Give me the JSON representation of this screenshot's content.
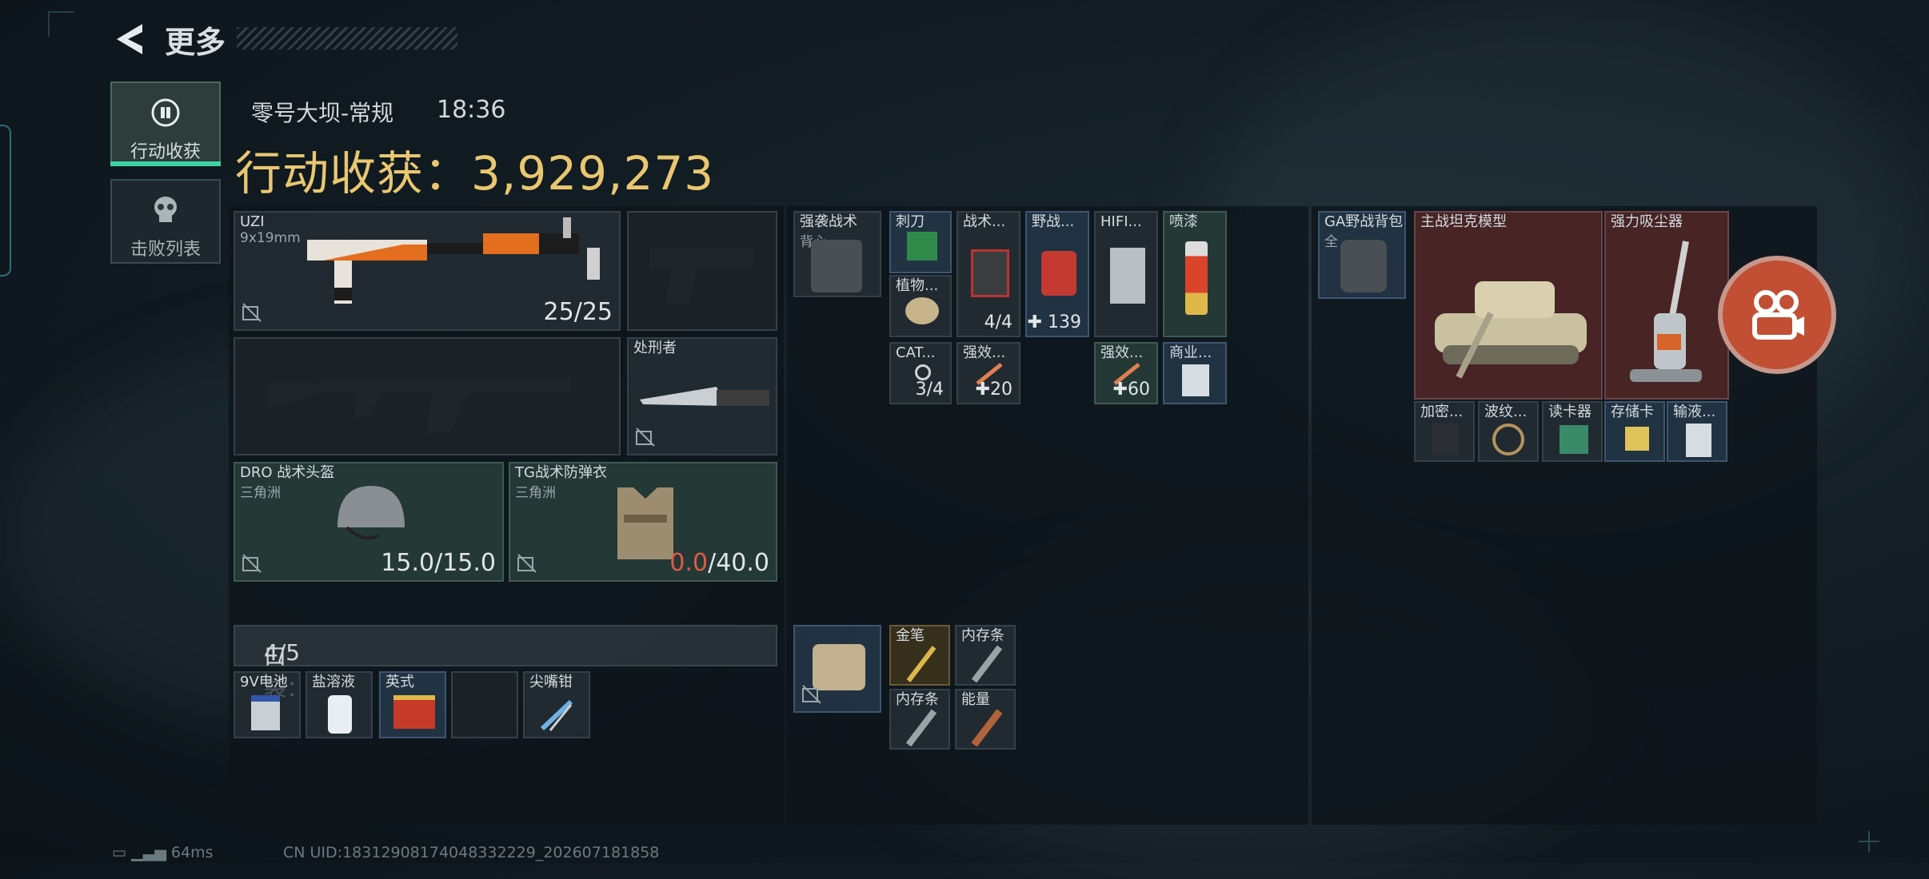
{
  "header": {
    "title": "更多"
  },
  "tabs": [
    {
      "label": "行动收获",
      "icon": "loot-icon",
      "active": true
    },
    {
      "label": "击败列表",
      "icon": "skull-icon",
      "active": false
    }
  ],
  "raid": {
    "map": "零号大坝-常规",
    "time": "18:36",
    "haul_label": "行动收获：",
    "haul_value": "3,929,273"
  },
  "equipment": {
    "primary": {
      "name": "UZI",
      "ammo_type": "9x19mm",
      "ammo": "25/25"
    },
    "melee": {
      "name": "处刑者"
    },
    "helmet": {
      "name": "DRO 战术头盔",
      "map": "三角洲",
      "durability": "15.0/15.0"
    },
    "armor": {
      "name": "TG战术防弹衣",
      "map": "三角洲",
      "durability_current": "0.0",
      "durability_max": "/40.0"
    }
  },
  "pocket": {
    "label": "口袋：",
    "count": "4/5",
    "items": [
      {
        "name": "9V电池"
      },
      {
        "name": "盐溶液"
      },
      {
        "name": "英式"
      },
      {
        "name": ""
      },
      {
        "name": "尖嘴钳"
      }
    ]
  },
  "rig": {
    "name": "强袭战术",
    "sub": "背心"
  },
  "rig_items": [
    {
      "name": "刺刀"
    },
    {
      "name": "战术..."
    },
    {
      "name": "野战..."
    },
    {
      "name": "HIFI..."
    },
    {
      "name": "喷漆"
    },
    {
      "name": "植物..."
    },
    {
      "name": "CAT..."
    },
    {
      "name": "强效..."
    },
    {
      "name": "强效..."
    },
    {
      "name": "商业..."
    }
  ],
  "rig_values": {
    "tactical": "4/4",
    "field": "139",
    "cat": "3/4",
    "strong1": "20",
    "strong2": "60"
  },
  "case_items": [
    {
      "name": "金笔"
    },
    {
      "name": "内存条"
    },
    {
      "name": "内存条"
    },
    {
      "name": "能量"
    }
  ],
  "backpack": {
    "name": "GA野战背包",
    "sub": "全"
  },
  "backpack_items": [
    {
      "name": "主战坦克模型"
    },
    {
      "name": "强力吸尘器"
    },
    {
      "name": "加密..."
    },
    {
      "name": "波纹..."
    },
    {
      "name": "读卡器"
    },
    {
      "name": "存储卡"
    },
    {
      "name": "输液..."
    }
  ],
  "footer": {
    "ping": "64ms",
    "uid": "CN UID:18312908174048332229_202607181858"
  }
}
